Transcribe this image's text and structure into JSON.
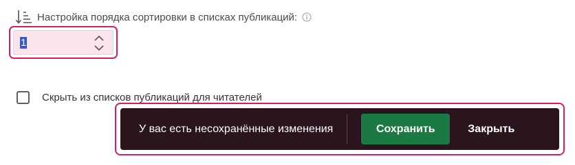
{
  "sort_order": {
    "label": "Настройка порядка сортировки в списках публикаций:",
    "value": "1",
    "icons": {
      "sort": "sort-ascending-icon",
      "info": "info-icon",
      "stepper": "chevron-up-down-icon"
    }
  },
  "hide_option": {
    "label": "Скрыть из списков публикаций для читателей",
    "checked": false
  },
  "toast": {
    "message": "У вас есть несохранённые изменения",
    "save_label": "Сохранить",
    "close_label": "Закрыть"
  },
  "colors": {
    "focus_ring": "#d81b60",
    "toast_background": "#2a141e",
    "save_button": "#1b7a43",
    "selection": "#3457d5",
    "input_background": "#fce4ec"
  }
}
